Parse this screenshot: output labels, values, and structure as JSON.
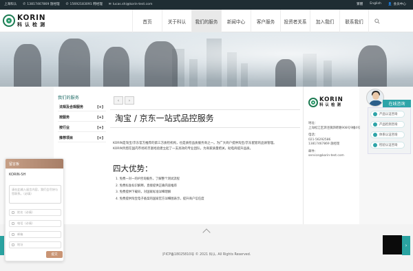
{
  "topbar": {
    "location": "上海科认",
    "phone1": "13817467869 施经理",
    "phone2": "15692183091 韩经理",
    "email": "lucas.shi@korin-test.com",
    "links": [
      "繁體",
      "English",
      "会员中心"
    ]
  },
  "logo": {
    "en": "KORIN",
    "cn": "科认检测"
  },
  "nav": {
    "items": [
      "首页",
      "关于科认",
      "我们的服务",
      "新闻中心",
      "客户服务",
      "投资者关系",
      "加入我们",
      "联系我们"
    ],
    "active_index": 2
  },
  "sidebar": {
    "title": "我们的服务",
    "items": [
      {
        "label": "法规及合规服务",
        "toggle": "[+]"
      },
      {
        "label": "按服务",
        "toggle": "[+]"
      },
      {
        "label": "按行业",
        "toggle": "[+]"
      },
      {
        "label": "推荐项目",
        "toggle": "[+]"
      }
    ]
  },
  "pager": {
    "prev": "‹",
    "next": "›"
  },
  "main": {
    "title": "淘宝 / 京东一站式品控服务",
    "intro_lines": [
      "KORIN是淘宝/京东官方推荐的第三方质检机构，也是质检品质服务商之一。为广大商户提供淘宝/京东配套的品质管理。",
      "KORIN凭借在国内市场的丰富经验建立起了一支高效的专业团队，为商家质量把关，助电商提升品质。"
    ],
    "advantages_title": "四大优势：",
    "advantages": [
      "1. 免费一对一的IP咨询服务，了解整个测试流程",
      "2. 免费标准标识解释，直接提供正确内容推荐",
      "3. 免费提供下载码，对国家标准详细理解",
      "4. 免费提供淘宝电子备案的国家官方详细图表示，提升商户信任度"
    ]
  },
  "right": {
    "logo_en": "KORIN",
    "logo_cn": "科认检测",
    "address_label": "地址：",
    "address": "上海松江区泗泾镇泗砖路908号9幢4号",
    "phone_label": "电话：",
    "phone1": "021-56292586",
    "phone2": "13817467869 施经理",
    "email_label": "邮件：",
    "email": "service@korin-test.com"
  },
  "consult": {
    "title": "在线咨询",
    "buttons": [
      "产品认证咨询",
      "产品检测咨询",
      "体系认证咨询",
      "检验认证咨询"
    ]
  },
  "form": {
    "header": "留言板",
    "title": "KORIN-SH",
    "textarea_placeholder": "请在此输入留言内容，我们会尽快与您联系。（必填）",
    "fields": [
      "姓名（必填）",
      "电话（必填）",
      "邮箱",
      "地址"
    ],
    "submit": "提交"
  },
  "footer": {
    "copyright": "沪ICP备18025810号 © 2021 科认. All Rights Reserved."
  },
  "colors": {
    "accent": "#2da4a8",
    "topbar": "#1f2d33",
    "form_header": "#b38c74"
  }
}
